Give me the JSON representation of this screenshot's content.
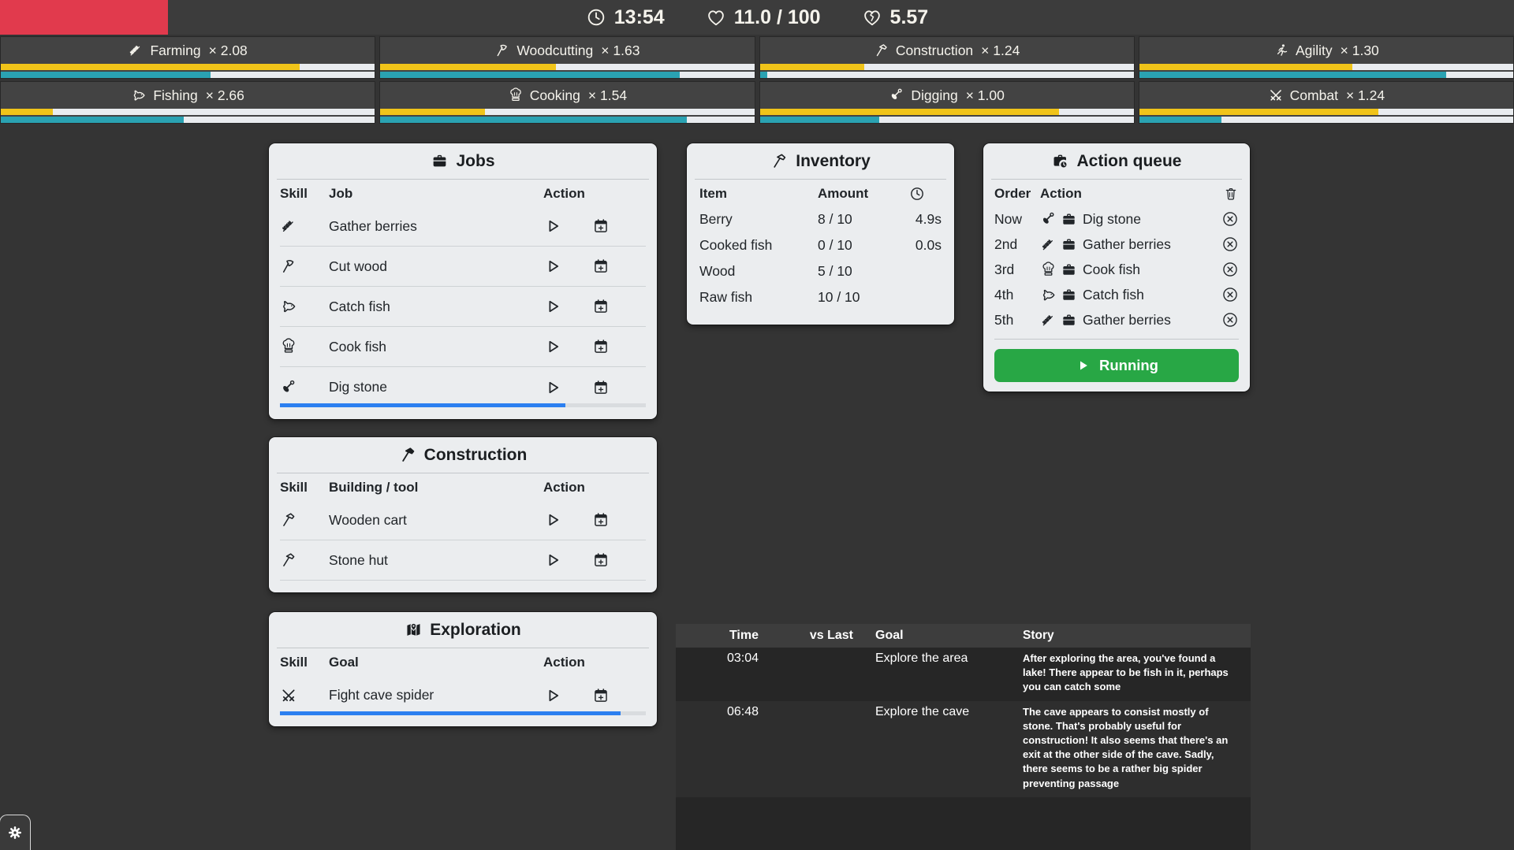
{
  "topbar": {
    "time": "13:54",
    "health": "11.0 / 100",
    "health_drain": "5.57"
  },
  "skills": [
    {
      "name": "Farming",
      "mult": "× 2.08",
      "xp_pct": 80,
      "speed_pct": 56
    },
    {
      "name": "Woodcutting",
      "mult": "× 1.63",
      "xp_pct": 47,
      "speed_pct": 80
    },
    {
      "name": "Construction",
      "mult": "× 1.24",
      "xp_pct": 28,
      "speed_pct": 2
    },
    {
      "name": "Agility",
      "mult": "× 1.30",
      "xp_pct": 57,
      "speed_pct": 82
    },
    {
      "name": "Fishing",
      "mult": "× 2.66",
      "xp_pct": 14,
      "speed_pct": 49
    },
    {
      "name": "Cooking",
      "mult": "× 1.54",
      "xp_pct": 28,
      "speed_pct": 82
    },
    {
      "name": "Digging",
      "mult": "× 1.00",
      "xp_pct": 80,
      "speed_pct": 32
    },
    {
      "name": "Combat",
      "mult": "× 1.24",
      "xp_pct": 64,
      "speed_pct": 22
    }
  ],
  "jobs": {
    "title": "Jobs",
    "col_skill": "Skill",
    "col_job": "Job",
    "col_action": "Action",
    "rows": [
      {
        "skill_icon": "wheat-icon",
        "job": "Gather berries"
      },
      {
        "skill_icon": "axe-icon",
        "job": "Cut wood"
      },
      {
        "skill_icon": "fish-icon",
        "job": "Catch fish"
      },
      {
        "skill_icon": "chef-hat-icon",
        "job": "Cook fish"
      },
      {
        "skill_icon": "shovel-icon",
        "job": "Dig stone",
        "progress_pct": 78
      }
    ]
  },
  "inventory": {
    "title": "Inventory",
    "col_item": "Item",
    "col_amount": "Amount",
    "rows": [
      {
        "item": "Berry",
        "amount": "8 / 10",
        "time": "4.9s"
      },
      {
        "item": "Cooked fish",
        "amount": "0 / 10",
        "time": "0.0s"
      },
      {
        "item": "Wood",
        "amount": "5 / 10",
        "time": ""
      },
      {
        "item": "Raw fish",
        "amount": "10 / 10",
        "time": ""
      }
    ]
  },
  "queue": {
    "title": "Action queue",
    "col_order": "Order",
    "col_action": "Action",
    "rows": [
      {
        "order": "Now",
        "skill_icon": "shovel-icon",
        "action": "Dig stone"
      },
      {
        "order": "2nd",
        "skill_icon": "wheat-icon",
        "action": "Gather berries"
      },
      {
        "order": "3rd",
        "skill_icon": "chef-hat-icon",
        "action": "Cook fish"
      },
      {
        "order": "4th",
        "skill_icon": "fish-icon",
        "action": "Catch fish"
      },
      {
        "order": "5th",
        "skill_icon": "wheat-icon",
        "action": "Gather berries"
      }
    ],
    "run_button": "Running"
  },
  "construction": {
    "title": "Construction",
    "col_skill": "Skill",
    "col_building": "Building / tool",
    "col_action": "Action",
    "rows": [
      {
        "building": "Wooden cart"
      },
      {
        "building": "Stone hut"
      }
    ]
  },
  "exploration": {
    "title": "Exploration",
    "col_skill": "Skill",
    "col_goal": "Goal",
    "col_action": "Action",
    "rows": [
      {
        "goal": "Fight cave spider",
        "progress_pct": 93
      }
    ]
  },
  "story": {
    "col_time": "Time",
    "col_vs_last": "vs Last",
    "col_goal": "Goal",
    "col_story": "Story",
    "rows": [
      {
        "time": "03:04",
        "vs_last": "",
        "goal": "Explore the area",
        "story": "After exploring the area, you've found a lake! There appear to be fish in it, perhaps you can catch some"
      },
      {
        "time": "06:48",
        "vs_last": "",
        "goal": "Explore the cave",
        "story": "The cave appears to consist mostly of stone. That's probably useful for construction! It also seems that there's an exit at the other side of the cave. Sadly, there seems to be a rather big spider preventing passage"
      }
    ]
  },
  "colors": {
    "alert_red": "#e13a4d",
    "xp_yellow": "#f0c419",
    "speed_teal": "#2aa2b2",
    "progress_blue": "#2b7ff0",
    "run_green": "#28a745"
  }
}
